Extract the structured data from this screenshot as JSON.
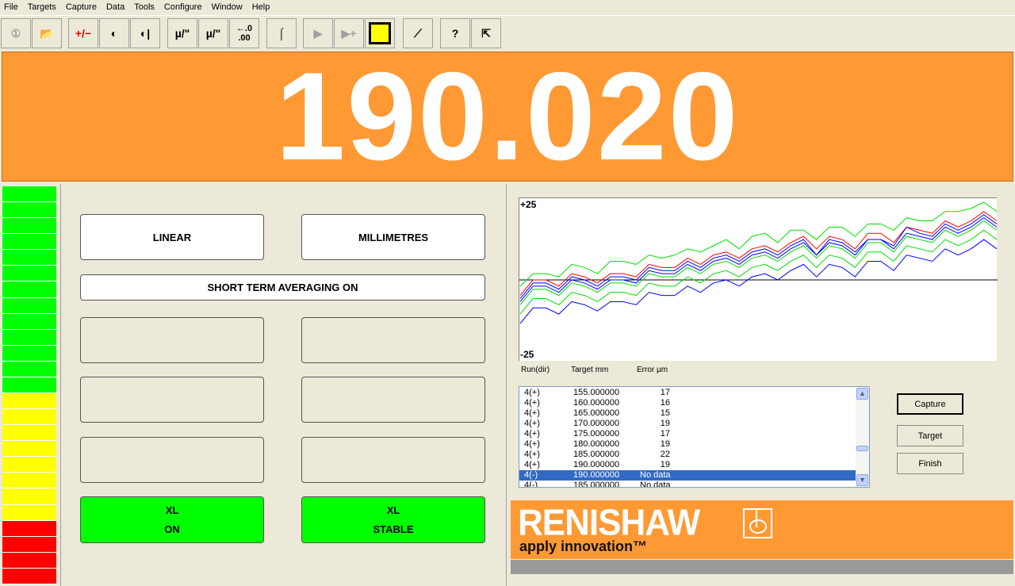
{
  "menu": [
    "File",
    "Targets",
    "Capture",
    "Data",
    "Tools",
    "Configure",
    "Window",
    "Help"
  ],
  "toolbar": [
    {
      "icon": "run-select-icon",
      "glyph": "①",
      "enabled": false
    },
    {
      "icon": "open-folder-icon",
      "glyph": "📂",
      "enabled": false
    },
    {
      "icon": "plus-minus-icon",
      "glyph": "+/−",
      "enabled": true
    },
    {
      "icon": "target-icon",
      "glyph": "◐",
      "enabled": true
    },
    {
      "icon": "target-datum-icon",
      "glyph": "◐|",
      "enabled": true
    },
    {
      "icon": "units-micron-icon",
      "glyph": "µ/\"",
      "enabled": true
    },
    {
      "icon": "units-micron-axis-icon",
      "glyph": "µ/\"",
      "enabled": true
    },
    {
      "icon": "resolution-icon",
      "glyph": "←.0 .00",
      "enabled": true
    },
    {
      "icon": "averaging-curve-icon",
      "glyph": "⌠",
      "enabled": true
    },
    {
      "icon": "play-icon",
      "glyph": "▶",
      "enabled": false
    },
    {
      "icon": "play-add-icon",
      "glyph": "▶+",
      "enabled": false
    },
    {
      "icon": "save-disk-icon",
      "glyph": "💾",
      "enabled": true
    },
    {
      "icon": "graph-icon",
      "glyph": "⟋",
      "enabled": true
    },
    {
      "icon": "help-icon",
      "glyph": "?",
      "enabled": true
    },
    {
      "icon": "exit-door-icon",
      "glyph": "⇱",
      "enabled": true
    }
  ],
  "display": {
    "reading": "190.020",
    "color": "#ff9933"
  },
  "meter": {
    "segments": [
      "#00ff00",
      "#00ff00",
      "#00ff00",
      "#00ff00",
      "#00ff00",
      "#00ff00",
      "#00ff00",
      "#00ff00",
      "#00ff00",
      "#00ff00",
      "#00ff00",
      "#00ff00",
      "#00ff00",
      "#ffff00",
      "#ffff00",
      "#ffff00",
      "#ffff00",
      "#ffff00",
      "#ffff00",
      "#ffff00",
      "#ffff00",
      "#ff0000",
      "#ff0000",
      "#ff0000",
      "#ff0000"
    ]
  },
  "panel": {
    "mode": "LINEAR",
    "units": "MILLIMETRES",
    "averaging": "SHORT TERM AVERAGING ON",
    "xl_on": [
      "XL",
      "ON"
    ],
    "xl_stable": [
      "XL",
      "STABLE"
    ]
  },
  "chart_data": {
    "type": "line",
    "ylim": [
      -25,
      25
    ],
    "ytick_top": "+25",
    "ytick_bottom": "-25",
    "baseline": 0,
    "x": [
      5,
      10,
      15,
      20,
      25,
      30,
      35,
      40,
      45,
      50,
      55,
      60,
      65,
      70,
      75,
      80,
      85,
      90,
      95,
      100,
      105,
      110,
      115,
      120,
      125,
      130,
      135,
      140,
      145,
      150,
      155,
      160,
      165,
      170,
      175,
      180,
      185,
      190
    ],
    "series": [
      {
        "color": "#00e000",
        "values": [
          -2,
          2,
          2,
          1,
          5,
          4,
          2,
          6,
          6,
          5,
          8,
          7,
          8,
          10,
          9,
          11,
          13,
          10,
          14,
          15,
          12,
          16,
          16,
          13,
          17,
          17,
          14,
          18,
          18,
          16,
          20,
          19,
          19,
          22,
          22,
          23,
          25,
          22
        ]
      },
      {
        "color": "#ff0000",
        "values": [
          -5,
          0,
          0,
          -2,
          2,
          1,
          -1,
          2,
          2,
          1,
          5,
          4,
          4,
          7,
          5,
          8,
          9,
          7,
          10,
          11,
          9,
          12,
          14,
          10,
          14,
          13,
          10,
          15,
          15,
          12,
          17,
          16,
          15,
          19,
          17,
          19,
          22,
          19
        ]
      },
      {
        "color": "#0000ff",
        "values": [
          -6,
          -1,
          -1,
          -3,
          1,
          0,
          -2,
          1,
          1,
          0,
          4,
          3,
          3,
          6,
          4,
          7,
          8,
          6,
          9,
          10,
          8,
          11,
          13,
          8,
          13,
          12,
          9,
          13,
          13,
          11,
          17,
          15,
          14,
          18,
          16,
          18,
          21,
          18
        ]
      },
      {
        "color": "#0000ff",
        "values": [
          -7,
          -2,
          -2,
          -4,
          0,
          -1,
          -3,
          0,
          0,
          -1,
          3,
          2,
          2,
          5,
          3,
          6,
          7,
          5,
          8,
          9,
          7,
          10,
          12,
          8,
          12,
          11,
          8,
          13,
          13,
          10,
          15,
          14,
          13,
          17,
          15,
          17,
          20,
          17
        ]
      },
      {
        "color": "#00e000",
        "values": [
          -8,
          -3,
          -3,
          -5,
          -1,
          -2,
          -4,
          -1,
          -1,
          -2,
          2,
          1,
          1,
          4,
          2,
          5,
          6,
          4,
          7,
          8,
          6,
          9,
          11,
          7,
          11,
          10,
          7,
          12,
          12,
          9,
          14,
          13,
          12,
          16,
          14,
          16,
          19,
          16
        ]
      },
      {
        "color": "#00e000",
        "values": [
          -11,
          -6,
          -6,
          -8,
          -4,
          -5,
          -7,
          -4,
          -4,
          -5,
          -1,
          -2,
          -2,
          1,
          -1,
          2,
          3,
          1,
          4,
          5,
          3,
          6,
          8,
          4,
          8,
          7,
          4,
          9,
          9,
          6,
          11,
          10,
          9,
          13,
          11,
          13,
          16,
          13
        ]
      },
      {
        "color": "#0000ff",
        "values": [
          -14,
          -9,
          -9,
          -11,
          -7,
          -8,
          -10,
          -7,
          -7,
          -8,
          -4,
          -5,
          -5,
          -2,
          -4,
          -1,
          0,
          -2,
          1,
          2,
          0,
          3,
          5,
          1,
          5,
          4,
          1,
          6,
          6,
          3,
          8,
          7,
          6,
          10,
          8,
          10,
          13,
          10
        ]
      }
    ]
  },
  "table": {
    "headers": [
      "Run(dir)",
      "Target mm",
      "Error µm"
    ],
    "rows": [
      [
        "4(+)",
        "155.000000",
        "17"
      ],
      [
        "4(+)",
        "160.000000",
        "16"
      ],
      [
        "4(+)",
        "165.000000",
        "15"
      ],
      [
        "4(+)",
        "170.000000",
        "19"
      ],
      [
        "4(+)",
        "175.000000",
        "17"
      ],
      [
        "4(+)",
        "180.000000",
        "19"
      ],
      [
        "4(+)",
        "185.000000",
        "22"
      ],
      [
        "4(+)",
        "190.000000",
        "19"
      ],
      [
        "4(-)",
        "190.000000",
        "No data"
      ],
      [
        "4(-)",
        "185.000000",
        "No data"
      ]
    ],
    "selected": 8
  },
  "buttons": {
    "capture": "Capture",
    "target": "Target",
    "finish": "Finish"
  },
  "logo": {
    "brand": "RENISHAW",
    "tagline": "apply innovation™"
  }
}
